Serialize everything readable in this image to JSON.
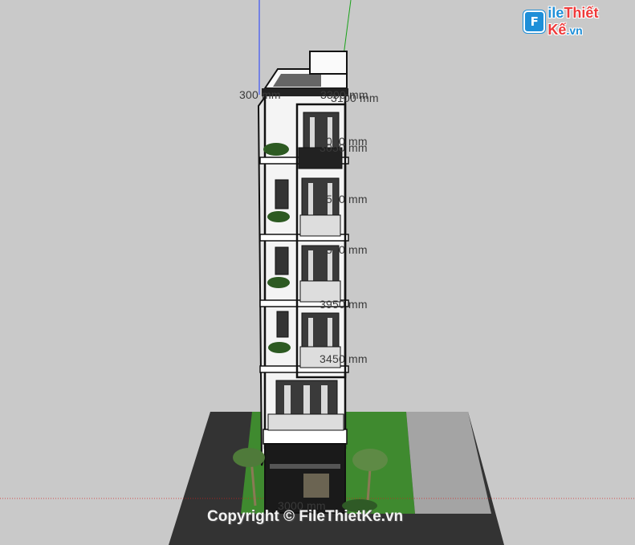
{
  "watermark": {
    "logo_badge": "F",
    "logo_part1": "ile",
    "logo_part2": "Thiết Kế",
    "logo_part3": ".vn",
    "copyright": "Copyright © FileThietKe.vn"
  },
  "dimensions": [
    {
      "id": "dim-roof-left",
      "text": "300 mm"
    },
    {
      "id": "dim-roof-right",
      "text": "3300 mm"
    },
    {
      "id": "dim-roof-right-overlap",
      "text": "3100 mm"
    },
    {
      "id": "dim-floor-5",
      "text": "3000 mm"
    },
    {
      "id": "dim-floor-5-overlap",
      "text": "3050 mm"
    },
    {
      "id": "dim-floor-4",
      "text": "3550 mm"
    },
    {
      "id": "dim-floor-3",
      "text": "3550 mm"
    },
    {
      "id": "dim-floor-2",
      "text": "3950 mm"
    },
    {
      "id": "dim-floor-1",
      "text": "3450 mm"
    },
    {
      "id": "dim-ground",
      "text": "3000 mm"
    }
  ],
  "colors": {
    "background": "#c9c9c9",
    "road": "#333333",
    "grass": "#3f8a2f",
    "sidewalk": "#a4a4a4",
    "facade": "#f4f4f4",
    "outline": "#111111",
    "axis_blue": "#1f3bff",
    "axis_green": "#1aa31a",
    "axis_red": "#d22222"
  }
}
